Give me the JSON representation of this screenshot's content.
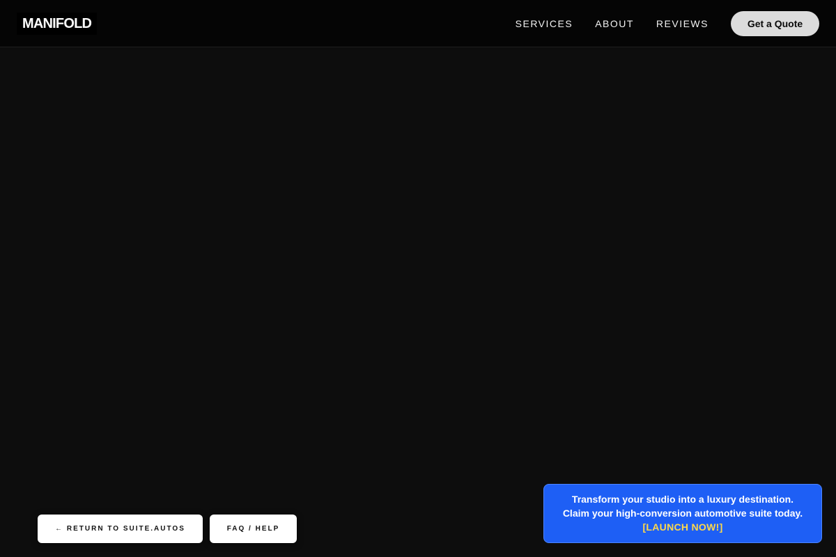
{
  "header": {
    "logo": "MANIFOLD",
    "nav": {
      "services": "SERVICES",
      "about": "ABOUT",
      "reviews": "REVIEWS"
    },
    "cta": "Get a Quote"
  },
  "footer_buttons": {
    "return": "← RETURN TO SUITE.AUTOS",
    "faq": "FAQ / HELP"
  },
  "promo": {
    "line1": "Transform your studio into a luxury destination.",
    "line2": "Claim your high-conversion automotive suite today.",
    "cta": "[LAUNCH NOW!]"
  },
  "colors": {
    "background": "#0d0d0d",
    "header": "#050505",
    "promo_bg": "#1e5ff5",
    "promo_cta": "#ffd84a",
    "quote_button": "#dcdcdc"
  }
}
